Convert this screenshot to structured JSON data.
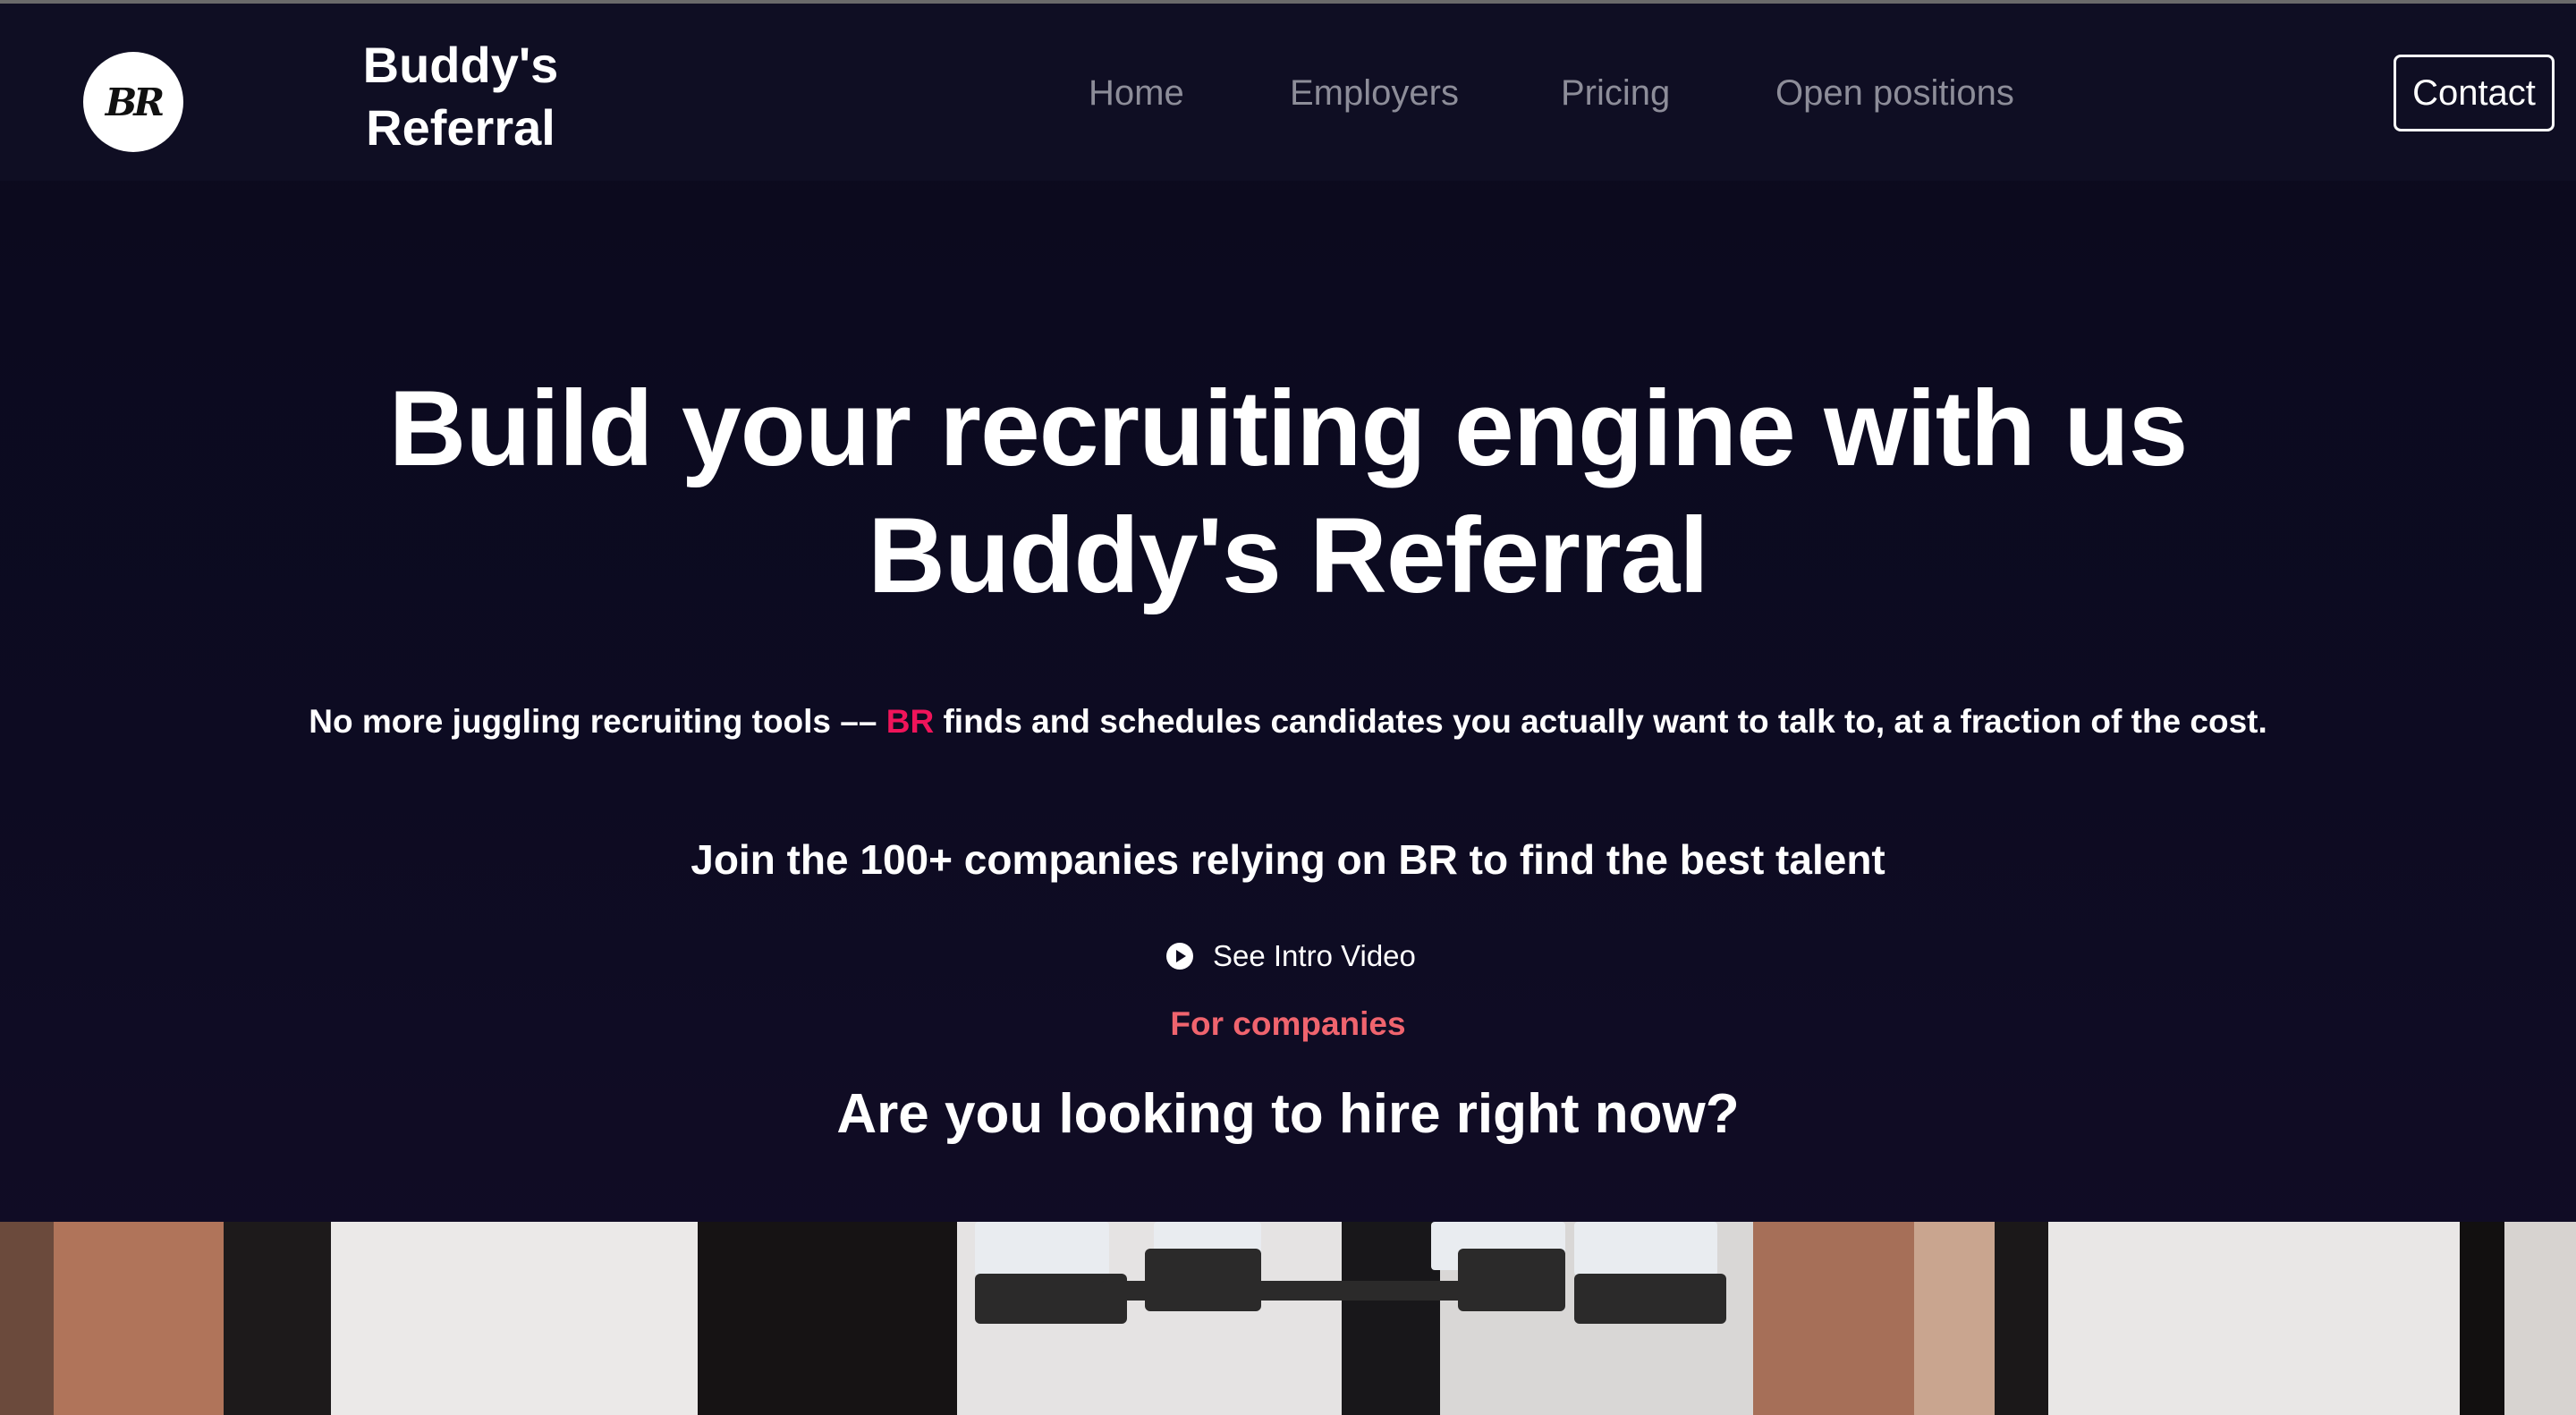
{
  "header": {
    "logo_text": "BR",
    "brand_line1": "Buddy's",
    "brand_line2": "Referral",
    "nav": [
      "Home",
      "Employers",
      "Pricing",
      "Open positions"
    ],
    "contact_label": "Contact"
  },
  "hero": {
    "title_line1": "Build your recruiting engine with us",
    "title_line2": "Buddy's Referral",
    "subtitle_before": "No more juggling recruiting tools –– ",
    "subtitle_accent": "BR",
    "subtitle_after": " finds and schedules candidates you actually want to talk to, at a fraction of the cost.",
    "join_text": "Join the 100+ companies relying on BR to find the best talent",
    "video_label": "See Intro Video",
    "for_companies": "For companies",
    "hire_question": "Are you looking to hire right now?"
  },
  "colors": {
    "background": "#0d0b1f",
    "accent": "#f0145a",
    "accent_soft": "#f0646e",
    "nav_text": "#8d8d99"
  }
}
